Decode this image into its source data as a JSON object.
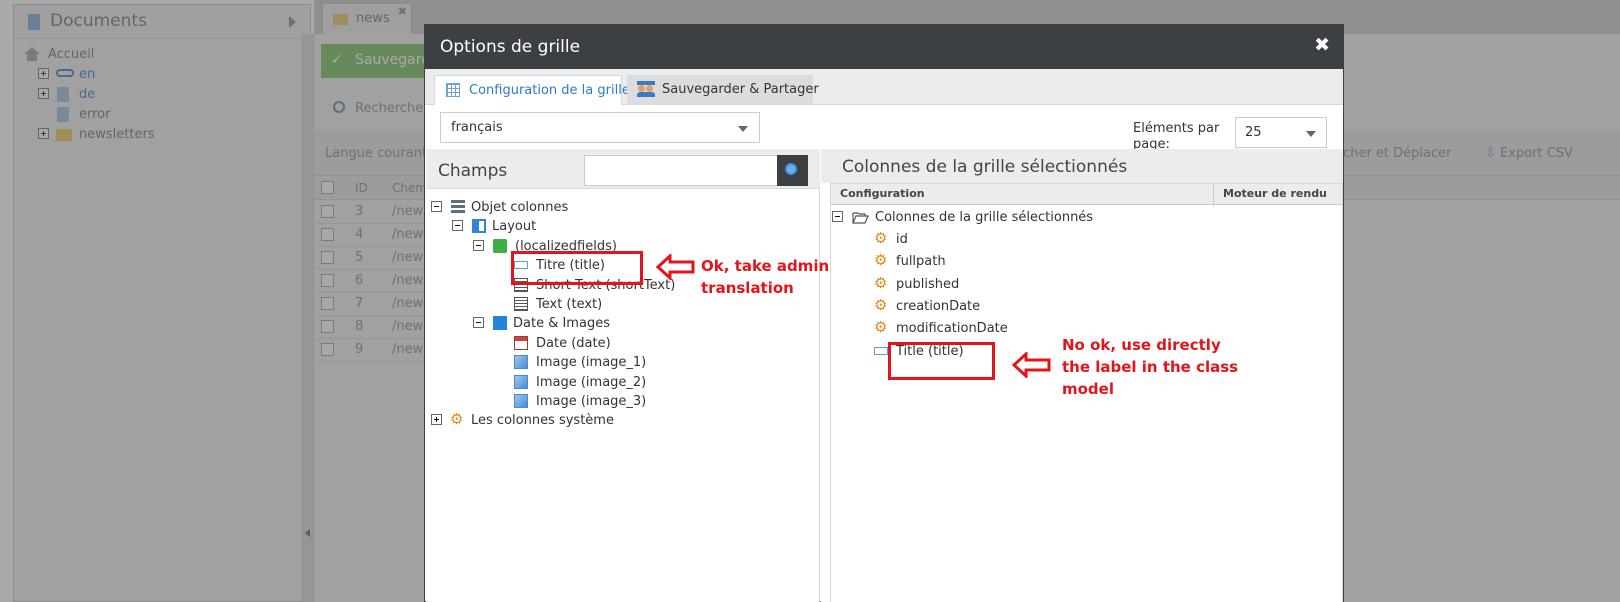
{
  "background": {
    "left_panel": {
      "title": "Documents",
      "tree": [
        {
          "label": "Accueil",
          "icon": "home-icon"
        },
        {
          "label": "en",
          "icon": "link-icon"
        },
        {
          "label": "de",
          "icon": "page-icon"
        },
        {
          "label": "error",
          "icon": "page-icon"
        },
        {
          "label": "newsletters",
          "icon": "folder-icon"
        }
      ]
    },
    "tab": {
      "label": "news"
    },
    "save_button": "Sauvegarder",
    "search_tab": "Recherche,",
    "language_label": "Langue courante",
    "toolbar_right": [
      "rcher et Déplacer",
      "Export CSV"
    ],
    "grid_headers": [
      "ID",
      "Chem"
    ],
    "rows": [
      {
        "id": "3",
        "path": "/new"
      },
      {
        "id": "4",
        "path": "/new"
      },
      {
        "id": "5",
        "path": "/new"
      },
      {
        "id": "6",
        "path": "/new"
      },
      {
        "id": "7",
        "path": "/new"
      },
      {
        "id": "8",
        "path": "/new"
      },
      {
        "id": "9",
        "path": "/new"
      }
    ]
  },
  "dialog": {
    "title": "Options de grille",
    "close_glyph": "✖",
    "tabs": [
      {
        "label": "Configuration de la grille",
        "active": true
      },
      {
        "label": "Sauvegarder & Partager",
        "active": false
      }
    ],
    "language_select": {
      "value": "français"
    },
    "per_page": {
      "label": "Eléments par page:",
      "value": "25"
    },
    "fields": {
      "title": "Champs",
      "search_placeholder": "",
      "tree": {
        "objects": "Objet colonnes",
        "layout": "Layout",
        "localized": "(localizedfields)",
        "titre": "Titre (title)",
        "short_text": "Short Text (shortText)",
        "text": "Text (text)",
        "date_images": "Date & Images",
        "date": "Date (date)",
        "image1": "Image (image_1)",
        "image2": "Image (image_2)",
        "image3": "Image (image_3)",
        "system": "Les colonnes système"
      }
    },
    "selected": {
      "title": "Colonnes de la grille sélectionnés",
      "headers": [
        "Configuration",
        "Moteur de rendu"
      ],
      "root": "Colonnes de la grille sélectionnés",
      "items": [
        "id",
        "fullpath",
        "published",
        "creationDate",
        "modificationDate",
        "Title (title)"
      ]
    }
  },
  "annotations": {
    "left": "Ok, take admin translation",
    "right": "No ok, use directly the label in the class model"
  },
  "colors": {
    "annotation": "#e4141b",
    "dialog_header": "#3c3f44",
    "active_tab_text": "#2b7bc8"
  }
}
